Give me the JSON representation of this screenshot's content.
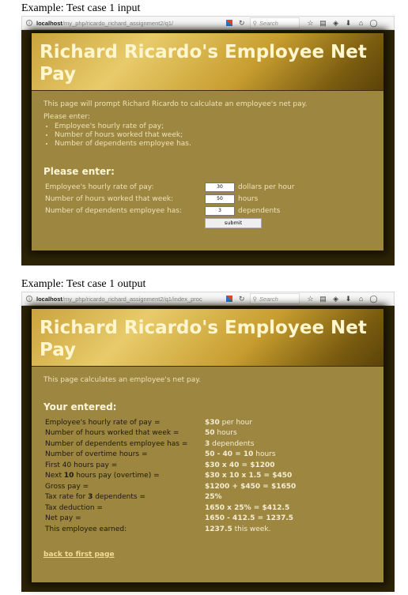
{
  "input_section": {
    "caption": "Example: Test case 1 input",
    "browser": {
      "url_host": "localhost",
      "url_path": "/my_php/ricardo_richard_assignment2/q1/",
      "search_placeholder": "Search"
    },
    "title": "Richard Ricardo's Employee Net Pay",
    "intro": "This page will prompt Richard Ricardo to calculate an employee's net pay.",
    "please_enter": "Please enter:",
    "bullets": [
      "Employee's hourly rate of pay;",
      "Number of hours worked that week;",
      "Number of dependents employee has."
    ],
    "form_heading": "Please enter:",
    "fields": [
      {
        "label": "Employee's hourly rate of pay:",
        "value": "30",
        "unit": "dollars per hour"
      },
      {
        "label": "Number of hours worked that week:",
        "value": "50",
        "unit": "hours"
      },
      {
        "label": "Number of dependents employee has:",
        "value": "3",
        "unit": "dependents"
      }
    ],
    "submit_label": "submit"
  },
  "output_section": {
    "caption": "Example: Test case 1 output",
    "browser": {
      "url_host": "localhost",
      "url_path": "/my_php/ricardo_richard_assignment2/q1/index_proc",
      "search_placeholder": "Search"
    },
    "title": "Richard Ricardo's Employee Net Pay",
    "intro": "This page calculates an employee's net pay.",
    "heading": "Your entered:",
    "rows": [
      {
        "label": "Employee's hourly rate of pay =",
        "bold": "$30",
        "rest": " per hour"
      },
      {
        "label": "Number of hours worked that week =",
        "bold": "50",
        "rest": " hours"
      },
      {
        "label": "Number of dependents employee has =",
        "bold": "3",
        "rest": " dependents"
      },
      {
        "label": "Number of overtime hours =",
        "bold": "50 - 40 = 10",
        "rest": " hours"
      },
      {
        "label": "First 40 hours pay =",
        "bold": "$30 x 40 = $1200",
        "rest": ""
      },
      {
        "label_pre": "Next ",
        "label_bold": "10",
        "label_post": " hours pay (overtime) =",
        "bold": "$30 x 10 x 1.5 = $450",
        "rest": ""
      },
      {
        "label": "Gross pay =",
        "bold": "$1200 + $450 = $1650",
        "rest": ""
      },
      {
        "label_pre": "Tax rate for ",
        "label_bold": "3",
        "label_post": " dependents =",
        "bold": "25%",
        "rest": ""
      },
      {
        "label": "Tax deduction =",
        "bold": "1650 x 25% = $412.5",
        "rest": ""
      },
      {
        "label": "Net pay =",
        "bold": "1650 - 412.5 = 1237.5",
        "rest": ""
      },
      {
        "label": "This employee earned:",
        "bold": "1237.5",
        "rest": " this week."
      }
    ],
    "back_link": "back to first page"
  }
}
